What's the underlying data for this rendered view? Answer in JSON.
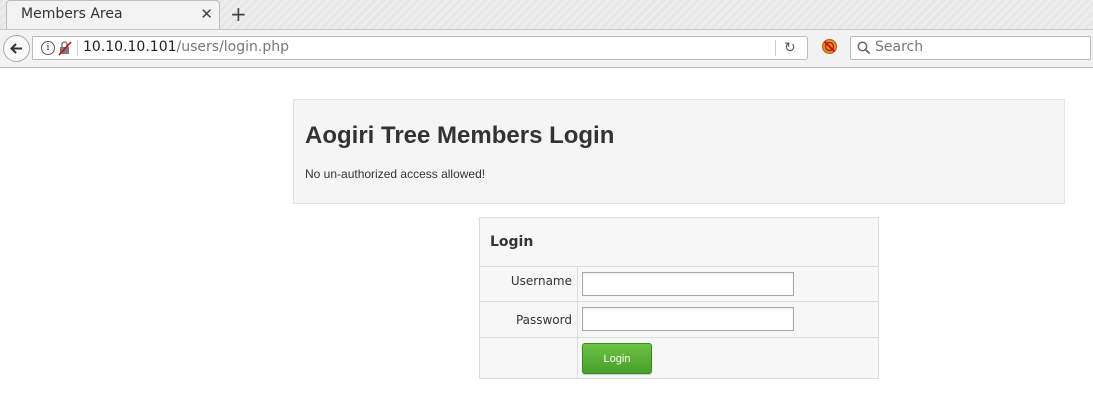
{
  "browser": {
    "tab_title": "Members Area",
    "tab_close": "✕",
    "new_tab": "+",
    "url_host": "10.10.10.101",
    "url_path": "/users/login.php",
    "search_placeholder": "Search"
  },
  "page": {
    "heading": "Aogiri Tree Members Login",
    "subtext": "No un-authorized access allowed!"
  },
  "login_form": {
    "title": "Login",
    "username_label": "Username",
    "username_value": "",
    "password_label": "Password",
    "password_value": "",
    "submit_label": "Login"
  },
  "colors": {
    "login_button": "#5ab436",
    "panel_background": "#f5f5f5"
  }
}
